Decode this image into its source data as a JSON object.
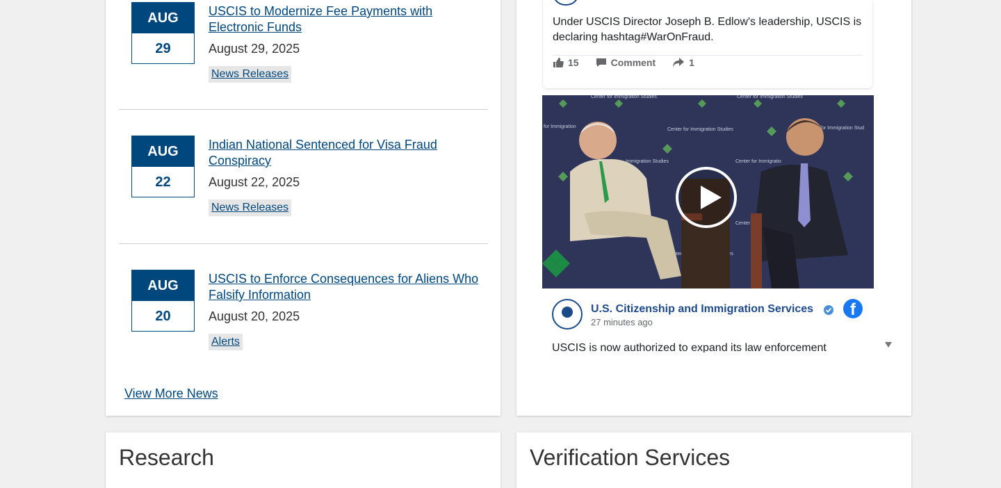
{
  "news": {
    "items": [
      {
        "month": "AUG",
        "day": "29",
        "title": "USCIS to Modernize Fee Payments with Electronic Funds",
        "date": "August 29, 2025",
        "tag": "News Releases"
      },
      {
        "month": "AUG",
        "day": "22",
        "title": "Indian National Sentenced for Visa Fraud Conspiracy",
        "date": "August 22, 2025",
        "tag": "News Releases"
      },
      {
        "month": "AUG",
        "day": "20",
        "title": "USCIS to Enforce Consequences for Aliens Who Falsify Information",
        "date": "August 20, 2025",
        "tag": "Alerts"
      }
    ],
    "view_more": "View More News"
  },
  "facebook": {
    "post1": {
      "text": "Under USCIS Director Joseph B. Edlow's leadership, USCIS is declaring hashtag#WarOnFraud.",
      "likes": "15",
      "comment_label": "Comment",
      "shares": "1"
    },
    "post2": {
      "page_name": "U.S. Citizenship and Immigration Services",
      "time": "27 minutes ago",
      "text": "USCIS is now authorized to expand its law enforcement"
    }
  },
  "sections": {
    "research": "Research",
    "verification": "Verification Services"
  },
  "colors": {
    "brand": "#00477d",
    "facebook": "#1877f2",
    "background": "#f0f0f0"
  },
  "icons": [
    "thumbs-up-icon",
    "comment-icon",
    "share-icon",
    "play-icon",
    "facebook-icon",
    "verified-icon",
    "scroll-down-icon"
  ]
}
